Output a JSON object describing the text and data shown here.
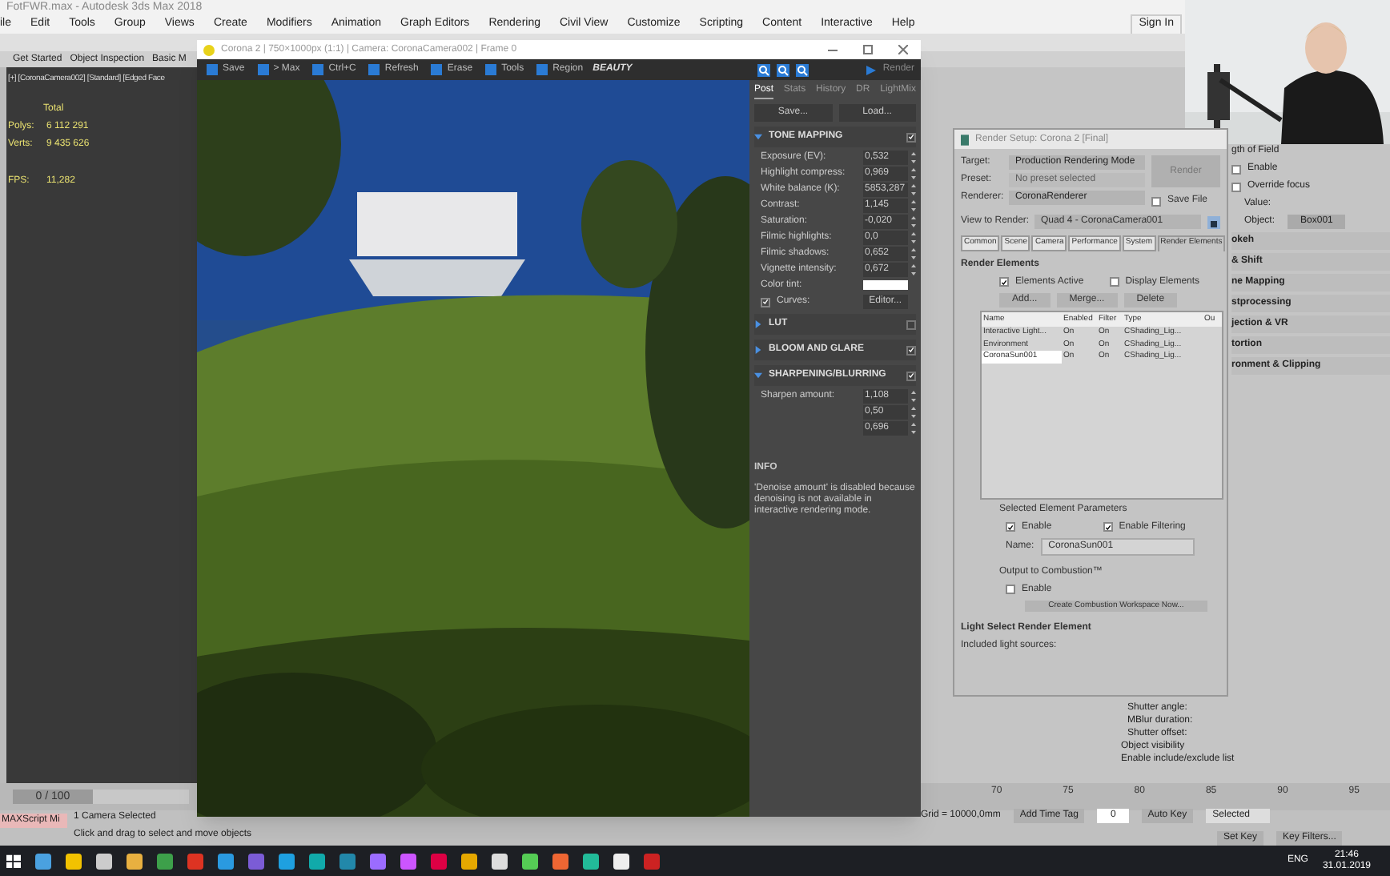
{
  "window": {
    "title": "FotFWR.max - Autodesk 3ds Max 2018"
  },
  "menu": [
    "ile",
    "Edit",
    "Tools",
    "Group",
    "Views",
    "Create",
    "Modifiers",
    "Animation",
    "Graph Editors",
    "Rendering",
    "Civil View",
    "Customize",
    "Scripting",
    "Content",
    "Interactive",
    "Help"
  ],
  "sign_in": "Sign In",
  "ribbon_tabs": [
    "Get Started",
    "Object Inspection",
    "Basic M"
  ],
  "viewport": {
    "label": "[+] [CoronaCamera002] [Standard] [Edged Face",
    "stats_heading": "Total",
    "stats": [
      {
        "label": "Polys:",
        "value": "6 112 291"
      },
      {
        "label": "Verts:",
        "value": "9 435 626"
      },
      {
        "label": "FPS:",
        "value": "11,282"
      }
    ]
  },
  "framebuffer": {
    "title": "Corona 2 | 750×1000px (1:1) | Camera: CoronaCamera002 | Frame 0",
    "tools": [
      "Save",
      "> Max",
      "Ctrl+C",
      "Refresh",
      "Erase",
      "Tools",
      "Region"
    ],
    "channel": "BEAUTY",
    "render_button": "Render",
    "tabs": [
      {
        "label": "Post",
        "selected": true
      },
      {
        "label": "Stats",
        "selected": false
      },
      {
        "label": "History",
        "selected": false
      },
      {
        "label": "DR",
        "selected": false
      },
      {
        "label": "LightMix",
        "selected": false
      }
    ],
    "buttons": [
      "Save...",
      "Load..."
    ],
    "sections": [
      {
        "title": "TONE MAPPING",
        "expanded": true,
        "enabled": true,
        "rows": [
          {
            "kind": "number",
            "label": "Exposure (EV):",
            "value": "0,532"
          },
          {
            "kind": "number",
            "label": "Highlight compress:",
            "value": "0,969"
          },
          {
            "kind": "number",
            "label": "White balance (K):",
            "value": "5853,287"
          },
          {
            "kind": "number",
            "label": "Contrast:",
            "value": "1,145"
          },
          {
            "kind": "number",
            "label": "Saturation:",
            "value": "-0,020"
          },
          {
            "kind": "number",
            "label": "Filmic highlights:",
            "value": "0,0"
          },
          {
            "kind": "number",
            "label": "Filmic shadows:",
            "value": "0,652"
          },
          {
            "kind": "number",
            "label": "Vignette intensity:",
            "value": "0,672"
          },
          {
            "kind": "color",
            "label": "Color tint:",
            "color": "#ffffff"
          },
          {
            "kind": "check",
            "label": "Curves:",
            "checked": true,
            "button": "Editor..."
          }
        ]
      },
      {
        "title": "LUT",
        "expanded": false,
        "enabled": false
      },
      {
        "title": "BLOOM AND GLARE",
        "expanded": false,
        "enabled": true
      },
      {
        "title": "SHARPENING/BLURRING",
        "expanded": true,
        "enabled": true,
        "rows": [
          {
            "kind": "number",
            "label": "Sharpen amount:",
            "value": "1,108"
          },
          {
            "kind": "number",
            "value": "0,50"
          },
          {
            "kind": "number",
            "value": "0,696"
          }
        ]
      }
    ],
    "info_title": "INFO",
    "info_text": "'Denoise amount' is disabled because denoising is not available in interactive rendering mode."
  },
  "render_setup": {
    "title": "Render Setup: Corona 2 [Final]",
    "fields": [
      {
        "label": "Target:",
        "value": "Production Rendering Mode",
        "disabled": false
      },
      {
        "label": "Preset:",
        "value": "No preset selected",
        "disabled": true
      },
      {
        "label": "Renderer:",
        "value": "CoronaRenderer",
        "disabled": false
      }
    ],
    "render_button": "Render",
    "save_file": {
      "label": "Save File",
      "checked": false
    },
    "view_label": "View to Render:",
    "view_value": "Quad 4 - CoronaCamera001",
    "tabs": [
      {
        "label": "Common",
        "selected": false
      },
      {
        "label": "Scene",
        "selected": false
      },
      {
        "label": "Camera",
        "selected": false
      },
      {
        "label": "Performance",
        "selected": false
      },
      {
        "label": "System",
        "selected": false
      },
      {
        "label": "Render Elements",
        "selected": true
      }
    ],
    "rollout": "Render Elements",
    "elements_active": {
      "label": "Elements Active",
      "checked": true
    },
    "display_elements": {
      "label": "Display Elements",
      "checked": false
    },
    "list_buttons": [
      "Add...",
      "Merge...",
      "Delete"
    ],
    "columns": [
      "Name",
      "Enabled",
      "Filter",
      "Type",
      "Ou"
    ],
    "rows": [
      {
        "cells": [
          "Interactive Light...",
          "On",
          "On",
          "CShading_Lig..."
        ],
        "selected": false
      },
      {
        "cells": [
          "Environment",
          "On",
          "On",
          "CShading_Lig..."
        ],
        "selected": false
      },
      {
        "cells": [
          "CoronaSun001",
          "On",
          "On",
          "CShading_Lig..."
        ],
        "selected": true
      }
    ],
    "params_title": "Selected Element Parameters",
    "enable": {
      "label": "Enable",
      "checked": true
    },
    "enable_filtering": {
      "label": "Enable Filtering",
      "checked": true
    },
    "name_label": "Name:",
    "name_value": "CoronaSun001",
    "combustion_title": "Output to Combustion™",
    "combustion_enable": {
      "label": "Enable",
      "checked": false
    },
    "combustion_button": "Create Combustion Workspace Now...",
    "light_rollout": "Light Select Render Element",
    "light_text": "Included light sources:"
  },
  "camera_panel": {
    "dof_title": "gth of Field",
    "checks": [
      {
        "label": "Enable",
        "checked": false
      },
      {
        "label": "Override focus",
        "checked": false
      }
    ],
    "value_label": "Value:",
    "object_label": "Object:",
    "object_value": "Box001",
    "rollouts": [
      "okeh",
      "& Shift",
      "ne Mapping",
      "stprocessing",
      "jection & VR",
      "tortion",
      "ronment & Clipping"
    ],
    "lower": [
      "Shutter angle:",
      "MBlur duration:",
      "Shutter offset:",
      "Object visibility",
      "Enable include/exclude list"
    ]
  },
  "timeline": {
    "frame": "0 / 100",
    "level": 0,
    "ticks": [
      "70",
      "75",
      "80",
      "85",
      "90",
      "95"
    ]
  },
  "status": {
    "script": "MAXScript Mi",
    "selection": "1 Camera Selected",
    "prompt": "Click and drag to select and move objects",
    "grid": "Grid = 10000,0mm",
    "time_tag": "Add Time Tag",
    "frame": "0",
    "auto_key": "Auto Key",
    "set_key": "Set Key",
    "selected": "Selected",
    "key_filters": "Key Filters..."
  },
  "taskbar": {
    "lang": "ENG",
    "time": "21:46",
    "date": "31.01.2019"
  }
}
